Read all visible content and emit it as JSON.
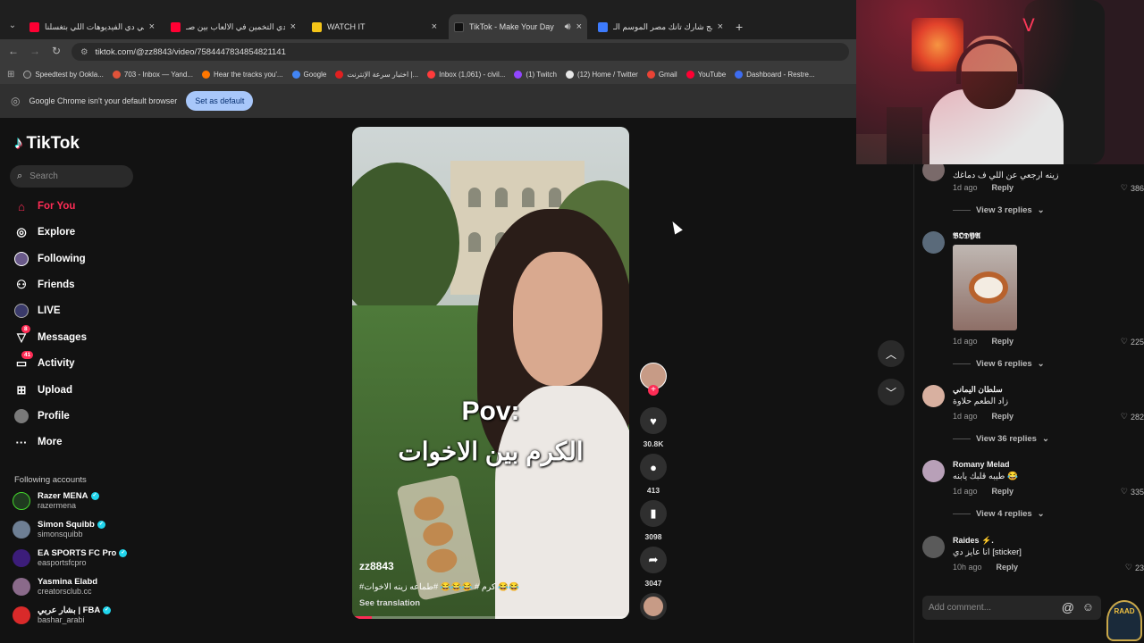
{
  "browser": {
    "tabs": [
      {
        "title": "هي دي الفيديوهات اللي بتغسلنا...",
        "favicon_color": "#ff0033"
      },
      {
        "title": "تحدي التخمين في الالعاب بين صـ...",
        "favicon_color": "#ff0033"
      },
      {
        "title": "WATCH IT",
        "favicon_color": "#f5c518"
      },
      {
        "title": "TikTok - Make Your Day",
        "favicon_color": "#111111"
      },
      {
        "title": "برنامج شارك تانك مصر الموسم الـ...",
        "favicon_color": "#3d7bfd"
      }
    ],
    "url": "tiktok.com/@zz8843/video/7584447834854821141",
    "bookmarks": [
      {
        "label": "Speedtest by Ookla...",
        "color": "#444"
      },
      {
        "label": "703 - Inbox — Yand...",
        "color": "#e0533a"
      },
      {
        "label": "Hear the tracks you'...",
        "color": "#ff7700"
      },
      {
        "label": "Google",
        "color": "#4285f4"
      },
      {
        "label": "اختبار سرعة الإنترنت |...",
        "color": "#e02020"
      },
      {
        "label": "Inbox (1,061) - civil...",
        "color": "#ff3b3b"
      },
      {
        "label": "(1) Twitch",
        "color": "#9146ff"
      },
      {
        "label": "(12) Home / Twitter",
        "color": "#e7e7e7"
      },
      {
        "label": "Gmail",
        "color": "#ea4335"
      },
      {
        "label": "YouTube",
        "color": "#ff0033"
      },
      {
        "label": "Dashboard - Restre...",
        "color": "#3d6cf0"
      }
    ],
    "infobar_text": "Google Chrome isn't your default browser",
    "infobar_button": "Set as default"
  },
  "sidebar": {
    "logo": "TikTok",
    "search_placeholder": "Search",
    "nav": [
      {
        "label": "For You",
        "icon": "home-icon",
        "active": true
      },
      {
        "label": "Explore",
        "icon": "compass-icon"
      },
      {
        "label": "Following",
        "icon": "following-icon"
      },
      {
        "label": "Friends",
        "icon": "friends-icon"
      },
      {
        "label": "LIVE",
        "icon": "live-icon"
      },
      {
        "label": "Messages",
        "icon": "messages-icon",
        "badge": "8"
      },
      {
        "label": "Activity",
        "icon": "activity-icon",
        "badge": "41"
      },
      {
        "label": "Upload",
        "icon": "upload-icon"
      },
      {
        "label": "Profile",
        "icon": "profile-icon"
      },
      {
        "label": "More",
        "icon": "more-icon"
      }
    ],
    "following_title": "Following accounts",
    "accounts": [
      {
        "name": "Razer MENA",
        "username": "razermena",
        "verified": true,
        "color": "#1f3b1f"
      },
      {
        "name": "Simon Squibb",
        "username": "simonsquibb",
        "verified": true,
        "color": "#6e7f94"
      },
      {
        "name": "EA SPORTS FC Pro",
        "username": "easportsfcpro",
        "verified": true,
        "color": "#3c1d7a"
      },
      {
        "name": "Yasmina Elabd",
        "username": "creatorsclub.cc",
        "verified": false,
        "color": "#8a6a8a"
      },
      {
        "name": "بشار عربي | FBA",
        "username": "bashar_arabi",
        "verified": true,
        "color": "#d92a2a"
      }
    ]
  },
  "video": {
    "overlay_title": "Pov:",
    "overlay_text": "الكرم بين الاخوات",
    "username": "zz8843",
    "caption": "#كرم # 😂😂😂 #طماعه زينه الاخوات 😂😂",
    "see_translation": "See translation",
    "progress": 0.07
  },
  "actions": {
    "likes": "30.8K",
    "comments": "413",
    "saves": "3098",
    "shares": "3047"
  },
  "comments": [
    {
      "text": "زينه ارجعي عن اللي ف دماغك",
      "time": "1d ago",
      "reply": "Reply",
      "likes": "386",
      "view_replies": "View 3 replies",
      "avatar": "#7a6a6a"
    },
    {
      "name": "𝕭𝕺𝕯𝖄𝕬",
      "time": "1d ago",
      "reply": "Reply",
      "likes": "225",
      "view_replies": "View 6 replies",
      "avatar": "#5a6a7a"
    },
    {
      "name": "سلطان اليماني",
      "text": "زاد الطعم حلاوة",
      "time": "1d ago",
      "reply": "Reply",
      "likes": "282",
      "view_replies": "View 36 replies",
      "avatar": "#d8b0a0"
    },
    {
      "name": "Romany Melad",
      "text": "طيبه قلبك يابنه 😂",
      "time": "1d ago",
      "reply": "Reply",
      "likes": "335",
      "view_replies": "View 4 replies",
      "avatar": "#b8a0b8"
    },
    {
      "name": "Raides ⚡.",
      "text": "انا عايز دي [sticker]",
      "time": "10h ago",
      "reply": "Reply",
      "likes": "23",
      "avatar": "#5a5a5a"
    }
  ],
  "add_comment_placeholder": "Add comment...",
  "overlay_logo": "RAAD",
  "accent": "#fe2c55"
}
